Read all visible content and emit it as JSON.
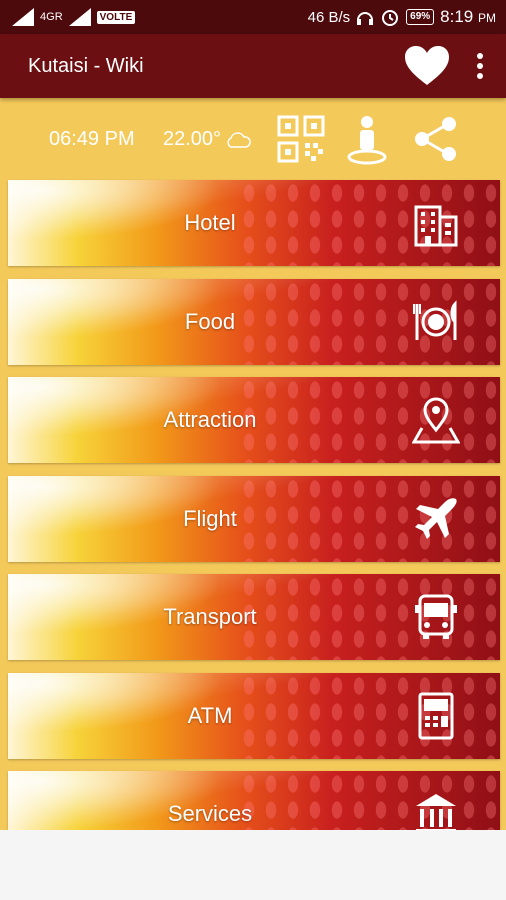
{
  "status_bar": {
    "network": "4G",
    "network_sub": "R",
    "volte": "VOLTE",
    "speed": "46 B/s",
    "battery": "69%",
    "time": "8:19",
    "ampm": "PM"
  },
  "app_bar": {
    "title": "Kutaisi - Wiki",
    "favorite_icon": "heart-icon",
    "menu_icon": "more-vert-icon"
  },
  "info": {
    "time": "06:49 PM",
    "temperature": "22.00°",
    "weather_icon": "cloud-icon",
    "qr_icon": "qr-code-icon",
    "person_icon": "person-location-icon",
    "share_icon": "share-icon"
  },
  "menu": {
    "items": [
      {
        "label": "Hotel",
        "icon": "hotel-building-icon"
      },
      {
        "label": "Food",
        "icon": "plate-cutlery-icon"
      },
      {
        "label": "Attraction",
        "icon": "map-pin-icon"
      },
      {
        "label": "Flight",
        "icon": "airplane-icon"
      },
      {
        "label": "Transport",
        "icon": "bus-icon"
      },
      {
        "label": "ATM",
        "icon": "atm-icon"
      },
      {
        "label": "Services",
        "icon": "bank-icon"
      }
    ]
  },
  "colors": {
    "status_bar": "#4c0a0d",
    "app_bar": "#6b0f12",
    "background": "#f3c95a"
  }
}
